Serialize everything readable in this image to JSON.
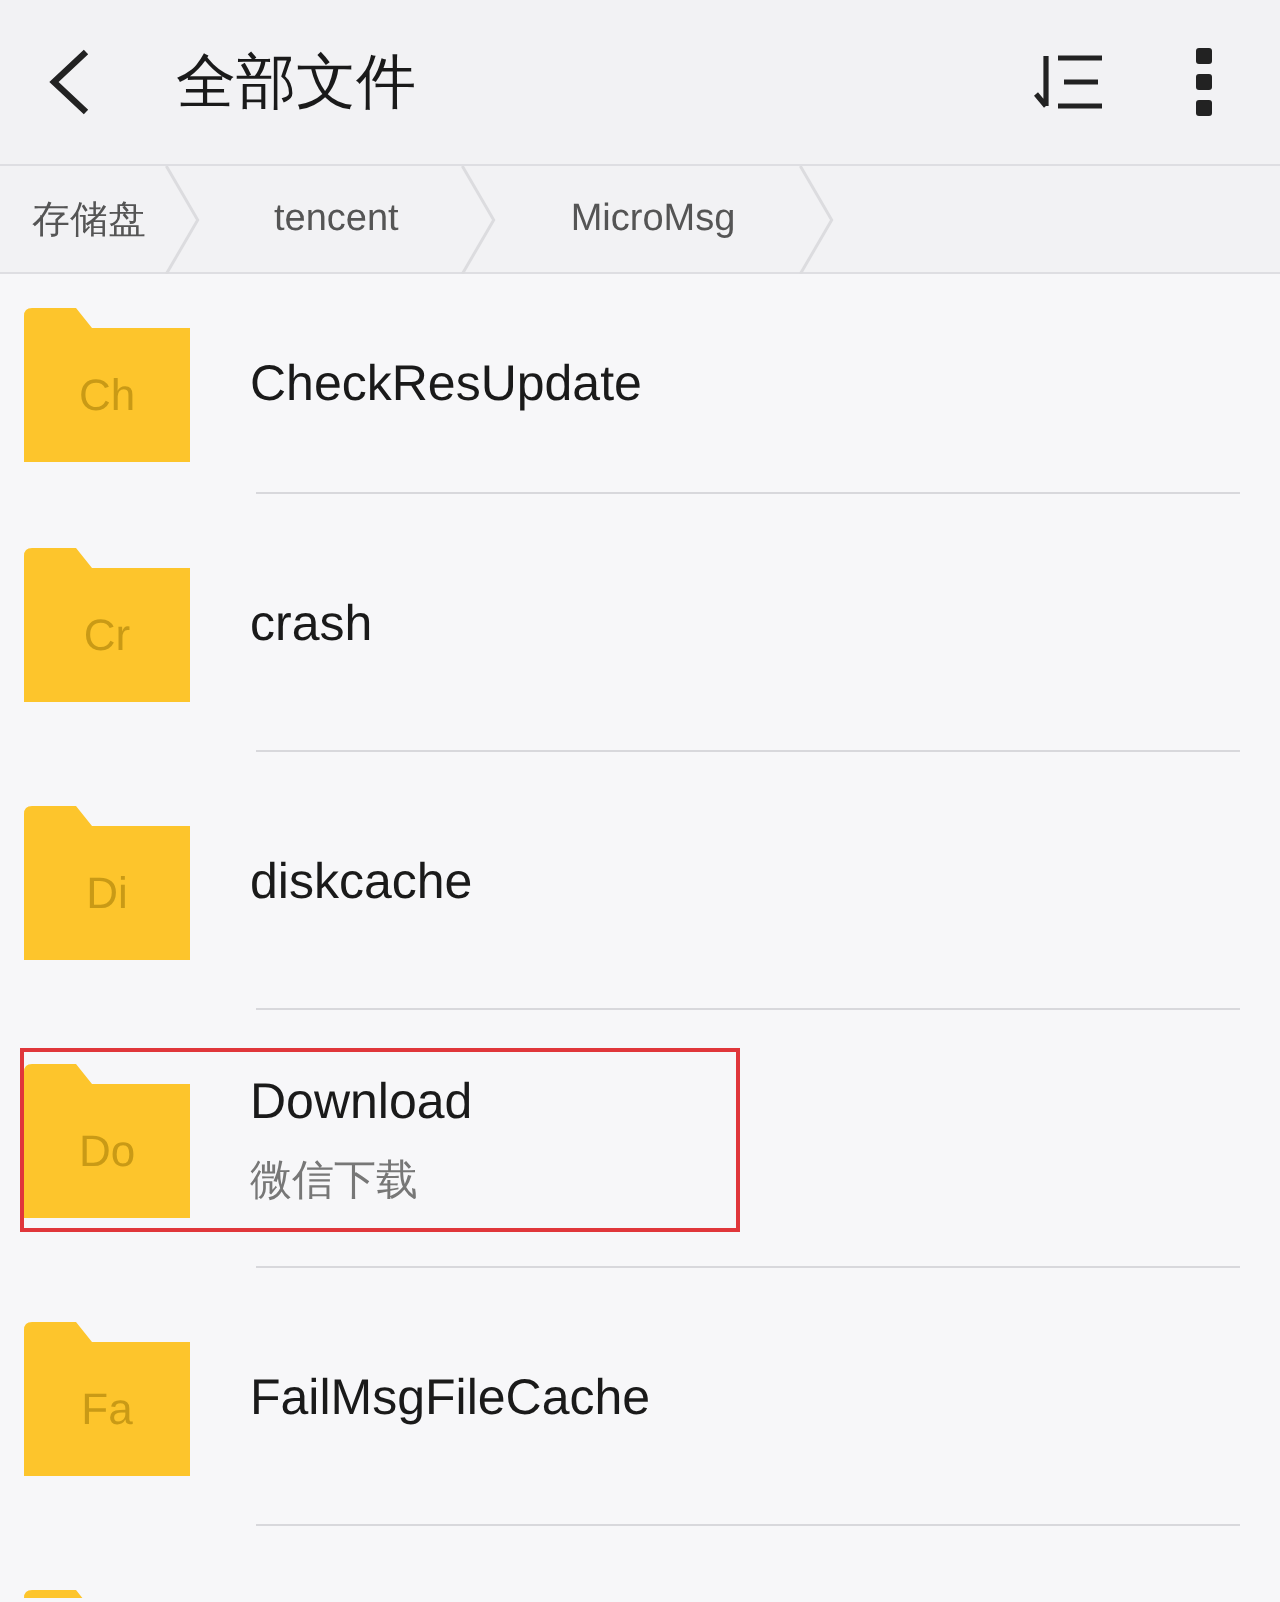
{
  "header": {
    "title": "全部文件"
  },
  "breadcrumb": [
    {
      "label": "存储盘"
    },
    {
      "label": "tencent"
    },
    {
      "label": "MicroMsg"
    }
  ],
  "folders": [
    {
      "kind": "folder",
      "abbr": "Ch",
      "name": "CheckResUpdate",
      "highlighted": false
    },
    {
      "kind": "folder",
      "abbr": "Cr",
      "name": "crash",
      "highlighted": false
    },
    {
      "kind": "folder",
      "abbr": "Di",
      "name": "diskcache",
      "highlighted": false
    },
    {
      "kind": "folder",
      "abbr": "Do",
      "name": "Download",
      "subtitle": "微信下载",
      "highlighted": true
    },
    {
      "kind": "folder",
      "abbr": "Fa",
      "name": "FailMsgFileCache",
      "highlighted": false
    },
    {
      "kind": "folder",
      "highlighted": false
    }
  ]
}
